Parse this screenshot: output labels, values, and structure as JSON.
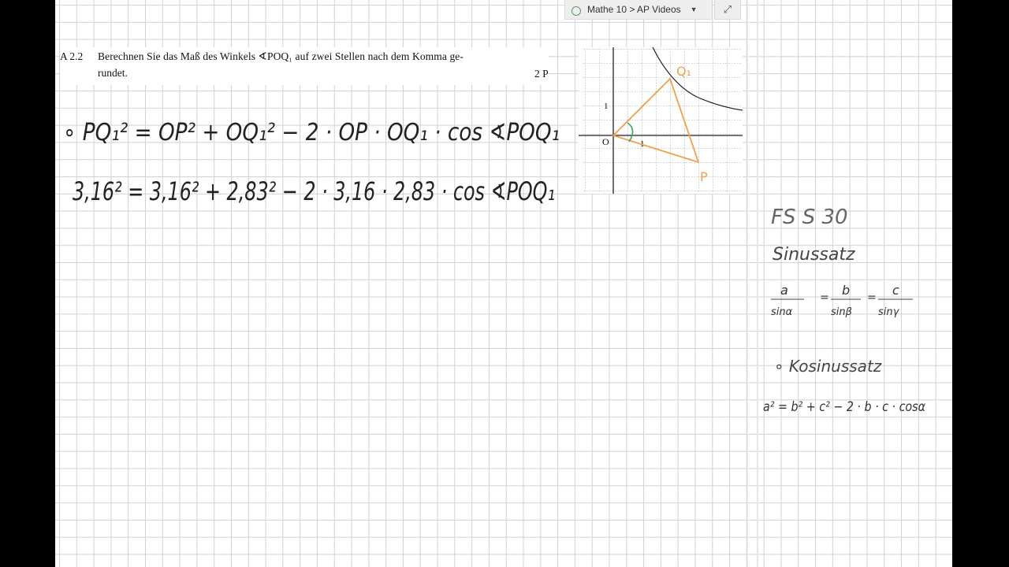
{
  "breadcrumb": {
    "text": "Mathe 10 > AP Videos"
  },
  "task": {
    "number": "A 2.2",
    "line1": "Berechnen Sie das Maß des Winkels ∢POQ₁ auf zwei Stellen nach dem Komma ge-",
    "line2": "rundet.",
    "points": "2 P"
  },
  "graph": {
    "origin_label": "O",
    "tick_x": "1",
    "tick_y": "1",
    "point_q": "Q₁",
    "point_p": "P"
  },
  "work": {
    "eq1": "∘ PQ₁² = OP² + OQ₁² − 2 · OP · OQ₁ · cos ∢POQ₁",
    "eq2": "3,16² = 3,16² + 2,83² − 2 · 3,16 · 2,83 · cos ∢POQ₁"
  },
  "notes": {
    "ref": "FS S 30",
    "sinussatz_title": "Sinussatz",
    "frac_a_num": "a",
    "frac_a_den": "sinα",
    "frac_b_num": "b",
    "frac_b_den": "sinβ",
    "frac_c_num": "c",
    "frac_c_den": "sinγ",
    "kosinussatz_title": "∘ Kosinussatz",
    "kosinussatz_formula": "a² = b² + c² − 2 · b · c · cosα"
  },
  "colors": {
    "accent_orange": "#f0a04b",
    "angle_green": "#3aa757",
    "ink": "#222222"
  }
}
